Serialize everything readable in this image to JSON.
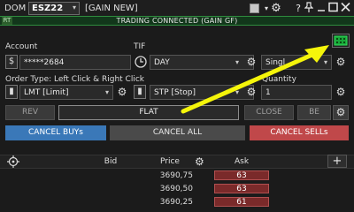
{
  "titlebar": {
    "dom_label": "DOM",
    "symbol": "ESZ22",
    "connection_label": "[GAIN NEW]"
  },
  "status": {
    "rt_badge": "RT",
    "text": "TRADING CONNECTED  (GAIN GF)"
  },
  "account": {
    "label": "Account",
    "icon": "dollar-icon",
    "value": "*****2684"
  },
  "tif": {
    "label": "TIF",
    "icon": "clock-icon",
    "value": "DAY",
    "secondary_value": "Singl"
  },
  "order_type": {
    "label": "Order Type: Left Click & Right Click",
    "left_value": "LMT [Limit]",
    "right_value": "STP [Stop]"
  },
  "quantity": {
    "label": "Quantity",
    "value": "1"
  },
  "position_row": {
    "rev": "REV",
    "flat": "FLAT",
    "close": "CLOSE",
    "be": "BE"
  },
  "cancel_row": {
    "cancel_buys": "CANCEL BUYs",
    "cancel_all": "CANCEL ALL",
    "cancel_sells": "CANCEL SELLs"
  },
  "ladder": {
    "headers": {
      "bid": "Bid",
      "price": "Price",
      "ask": "Ask"
    },
    "rows": [
      {
        "price": "3690,75",
        "ask": "63"
      },
      {
        "price": "3690,50",
        "ask": "63"
      },
      {
        "price": "3690,25",
        "ask": "61"
      }
    ]
  },
  "colors": {
    "status_bar": "#12371b",
    "cancel_buys": "#3a78b8",
    "cancel_sells": "#c0484a",
    "ask_cell": "#7a2a2a",
    "annotation_arrow": "#f5f50a"
  }
}
